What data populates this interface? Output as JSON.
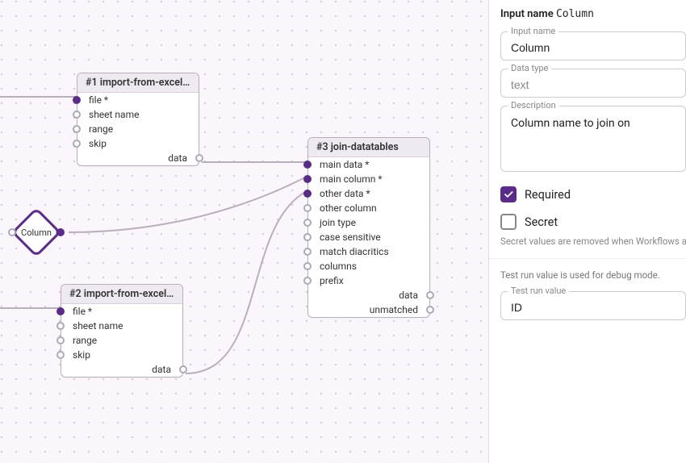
{
  "diamond": {
    "label": "Column"
  },
  "nodes": {
    "n1": {
      "title": "#1 import-from-excel...",
      "ports_in": [
        {
          "label": "file *",
          "filled": true
        },
        {
          "label": "sheet name",
          "filled": false
        },
        {
          "label": "range",
          "filled": false
        },
        {
          "label": "skip",
          "filled": false
        }
      ],
      "ports_out": [
        {
          "label": "data",
          "filled": false
        }
      ]
    },
    "n2": {
      "title": "#2 import-from-excel...",
      "ports_in": [
        {
          "label": "file *",
          "filled": true
        },
        {
          "label": "sheet name",
          "filled": false
        },
        {
          "label": "range",
          "filled": false
        },
        {
          "label": "skip",
          "filled": false
        }
      ],
      "ports_out": [
        {
          "label": "data",
          "filled": false
        }
      ]
    },
    "n3": {
      "title": "#3 join-datatables",
      "ports_in": [
        {
          "label": "main data *",
          "filled": true
        },
        {
          "label": "main column *",
          "filled": true
        },
        {
          "label": "other data *",
          "filled": true
        },
        {
          "label": "other column",
          "filled": false
        },
        {
          "label": "join type",
          "filled": false
        },
        {
          "label": "case sensitive",
          "filled": false
        },
        {
          "label": "match diacritics",
          "filled": false
        },
        {
          "label": "columns",
          "filled": false
        },
        {
          "label": "prefix",
          "filled": false
        }
      ],
      "ports_out": [
        {
          "label": "data",
          "filled": false
        },
        {
          "label": "unmatched",
          "filled": false
        }
      ]
    }
  },
  "panel": {
    "title_prefix": "Input name",
    "title_value": "Column",
    "input_name": {
      "legend": "Input name",
      "value": "Column"
    },
    "data_type": {
      "legend": "Data type",
      "value": "text"
    },
    "description": {
      "legend": "Description",
      "value": "Column name to join on"
    },
    "required": {
      "label": "Required",
      "checked": true
    },
    "secret": {
      "label": "Secret",
      "checked": false,
      "hint": "Secret values are removed when Workflows are exported"
    },
    "test_run": {
      "hint": "Test run value is used for debug mode.",
      "legend": "Test run value",
      "value": "ID"
    }
  }
}
